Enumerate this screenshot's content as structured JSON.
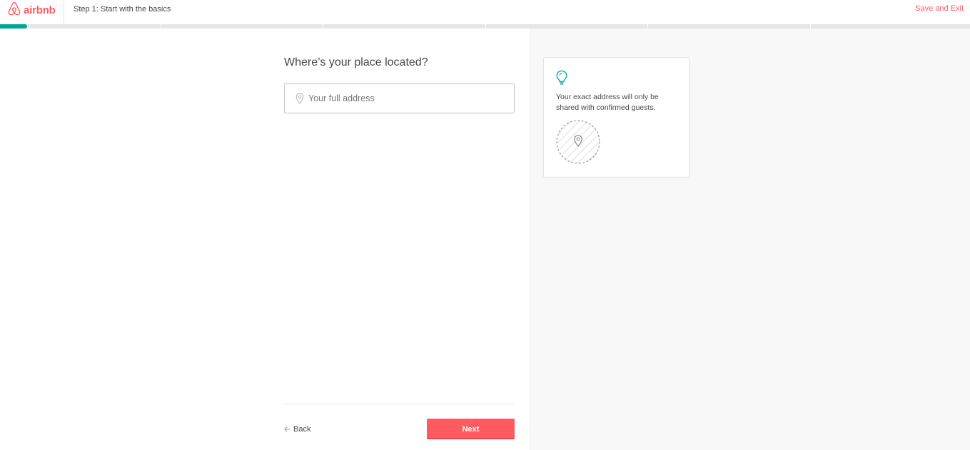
{
  "header": {
    "brand": "airbnb",
    "step_title": "Step 1: Start with the basics",
    "save_exit_label": "Save and Exit"
  },
  "progress": {
    "fraction_complete": 0.03,
    "segments": 6
  },
  "main": {
    "question": "Where’s your place located?",
    "address_field": {
      "placeholder": "Your full address",
      "value": ""
    },
    "back_label": "Back",
    "next_label": "Next"
  },
  "tip": {
    "text": "Your exact address will only be shared with confirmed guests."
  },
  "colors": {
    "brand": "#ff5a5f",
    "progress": "#00a699",
    "tip_icon": "#00a699"
  },
  "icons": {
    "logo": "airbnb-belo-icon",
    "address": "location-pin-icon",
    "back": "arrow-left-icon",
    "tip": "lightbulb-icon",
    "map": "map-pin-icon"
  }
}
